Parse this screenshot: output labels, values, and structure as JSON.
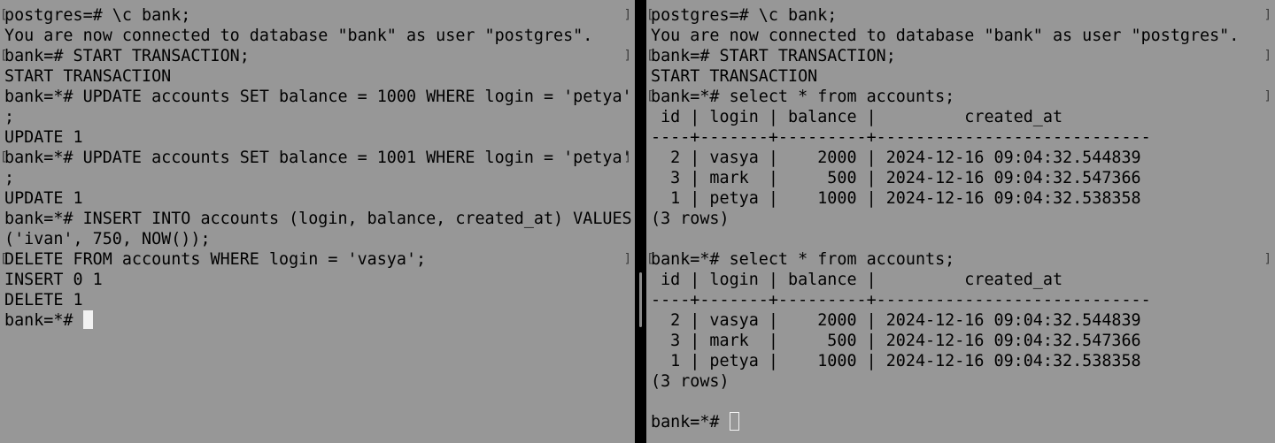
{
  "left_pane": {
    "lines": [
      {
        "text": "postgres=# \\c bank;",
        "marked": true
      },
      {
        "text": "You are now connected to database \"bank\" as user \"postgres\".",
        "marked": false
      },
      {
        "text": "bank=# START TRANSACTION;",
        "marked": true
      },
      {
        "text": "START TRANSACTION",
        "marked": false
      },
      {
        "text": "bank=*# UPDATE accounts SET balance = 1000 WHERE login = 'petya'",
        "marked": false
      },
      {
        "text": ";",
        "marked": false
      },
      {
        "text": "UPDATE 1",
        "marked": false
      },
      {
        "text": "bank=*# UPDATE accounts SET balance = 1001 WHERE login = 'petya'",
        "marked": true
      },
      {
        "text": ";",
        "marked": false
      },
      {
        "text": "UPDATE 1",
        "marked": false
      },
      {
        "text": "bank=*# INSERT INTO accounts (login, balance, created_at) VALUES",
        "marked": false
      },
      {
        "text": "('ivan', 750, NOW());",
        "marked": false
      },
      {
        "text": "DELETE FROM accounts WHERE login = 'vasya';",
        "marked": true
      },
      {
        "text": "INSERT 0 1",
        "marked": false
      },
      {
        "text": "DELETE 1",
        "marked": false
      }
    ],
    "prompt": "bank=*#"
  },
  "right_pane": {
    "lines": [
      {
        "text": "postgres=# \\c bank;",
        "marked": true
      },
      {
        "text": "You are now connected to database \"bank\" as user \"postgres\".",
        "marked": false
      },
      {
        "text": "bank=# START TRANSACTION;",
        "marked": true
      },
      {
        "text": "START TRANSACTION",
        "marked": false
      },
      {
        "text": "bank=*# select * from accounts;",
        "marked": true
      },
      {
        "text": " id | login | balance |         created_at",
        "marked": false
      },
      {
        "text": "----+-------+---------+----------------------------",
        "marked": false
      },
      {
        "text": "  2 | vasya |    2000 | 2024-12-16 09:04:32.544839",
        "marked": false
      },
      {
        "text": "  3 | mark  |     500 | 2024-12-16 09:04:32.547366",
        "marked": false
      },
      {
        "text": "  1 | petya |    1000 | 2024-12-16 09:04:32.538358",
        "marked": false
      },
      {
        "text": "(3 rows)",
        "marked": false
      },
      {
        "text": "",
        "marked": false
      },
      {
        "text": "bank=*# select * from accounts;",
        "marked": true
      },
      {
        "text": " id | login | balance |         created_at",
        "marked": false
      },
      {
        "text": "----+-------+---------+----------------------------",
        "marked": false
      },
      {
        "text": "  2 | vasya |    2000 | 2024-12-16 09:04:32.544839",
        "marked": false
      },
      {
        "text": "  3 | mark  |     500 | 2024-12-16 09:04:32.547366",
        "marked": false
      },
      {
        "text": "  1 | petya |    1000 | 2024-12-16 09:04:32.538358",
        "marked": false
      },
      {
        "text": "(3 rows)",
        "marked": false
      },
      {
        "text": "",
        "marked": false
      }
    ],
    "prompt": "bank=*#"
  },
  "colors": {
    "pane_background": "#979797",
    "divider": "#000000",
    "text": "#000000",
    "cursor": "#f2f2f2"
  }
}
